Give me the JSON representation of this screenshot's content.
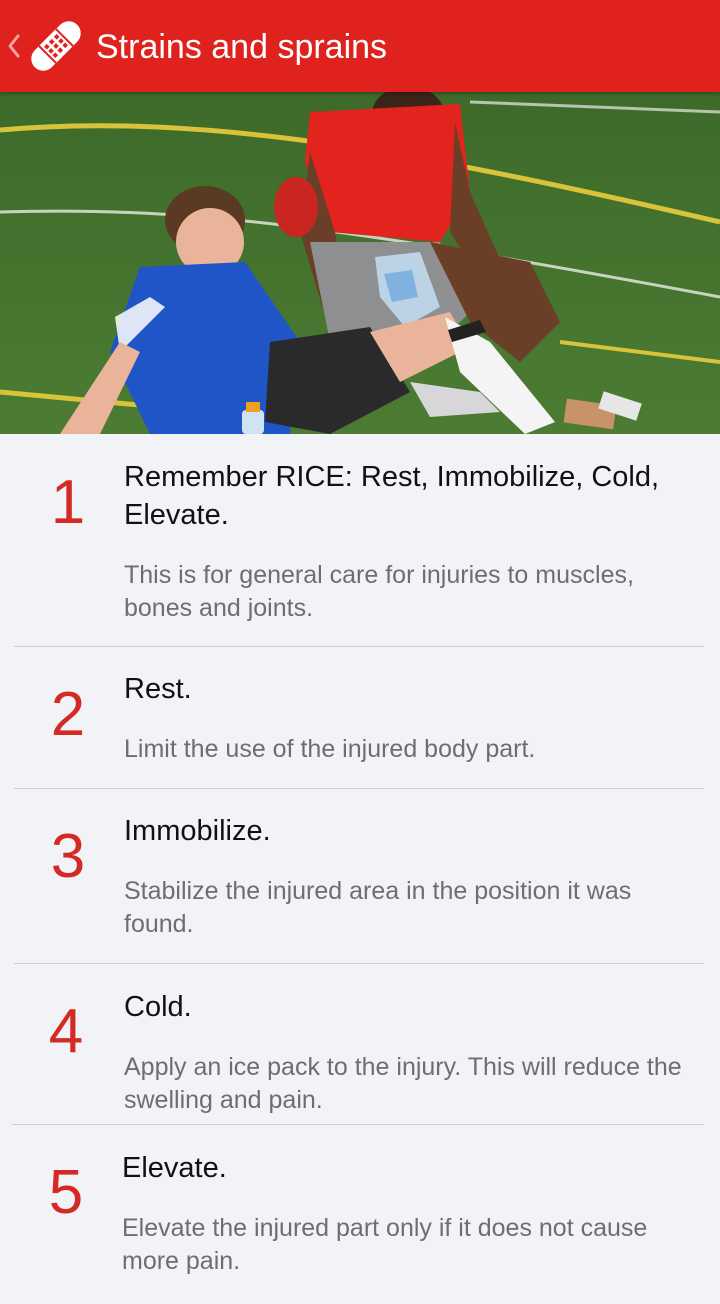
{
  "header": {
    "title": "Strains and sprains",
    "back_icon": "chevron-left-icon",
    "app_icon": "bandage-icon",
    "bg_color": "#e0221f"
  },
  "hero": {
    "image": "first-aid-scene-photo"
  },
  "steps": [
    {
      "number": "1",
      "title": "Remember RICE: Rest, Immobilize, Cold, Elevate.",
      "description": "This is for general care for injuries to muscles, bones and joints."
    },
    {
      "number": "2",
      "title": "Rest.",
      "description": "Limit the use of the injured body part."
    },
    {
      "number": "3",
      "title": "Immobilize.",
      "description": "Stabilize the injured area in the position it was found."
    },
    {
      "number": "4",
      "title": "Cold.",
      "description": "Apply an ice pack to the injury. This will reduce the swelling and pain."
    },
    {
      "number": "5",
      "title": "Elevate.",
      "description": "Elevate the injured part only if it does not cause more pain."
    }
  ],
  "colors": {
    "accent": "#e0221f",
    "step_number": "#d42a25",
    "title_text": "#111111",
    "desc_text": "#6e6e72",
    "background": "#f2f3f6"
  }
}
